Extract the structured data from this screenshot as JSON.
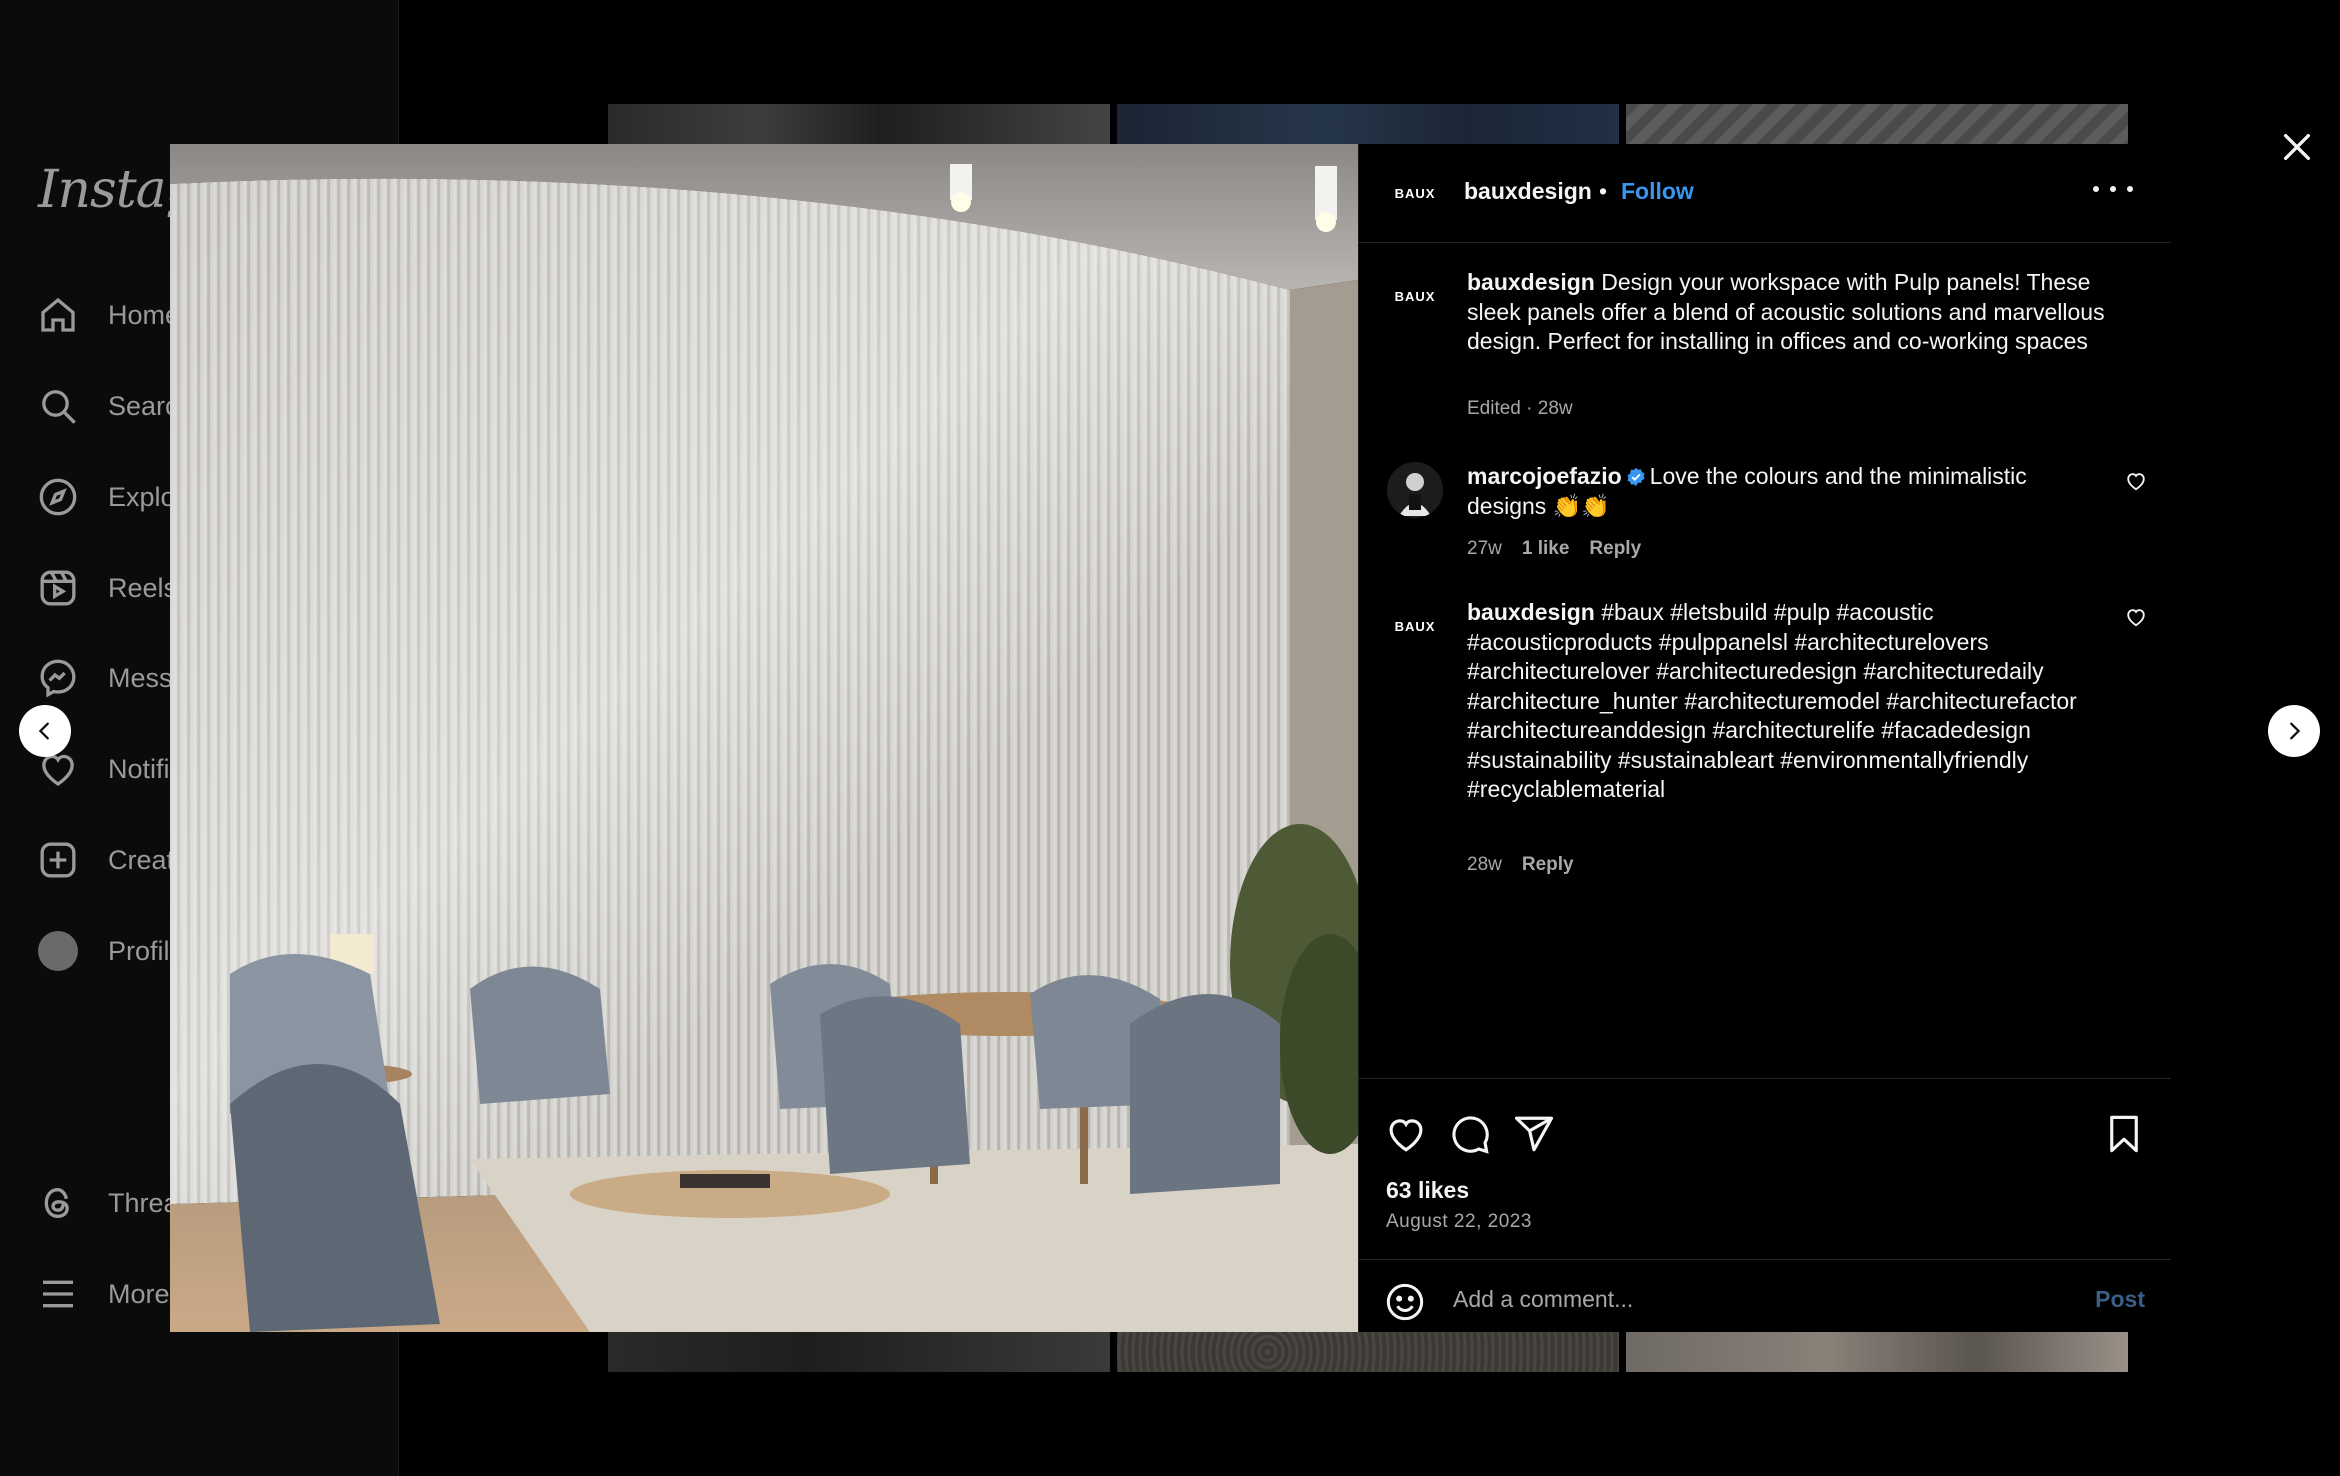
{
  "sidebar": {
    "logo": "Instagram",
    "items": [
      {
        "label": "Home",
        "icon": "home-icon"
      },
      {
        "label": "Search",
        "icon": "search-icon"
      },
      {
        "label": "Explore",
        "icon": "compass-icon"
      },
      {
        "label": "Reels",
        "icon": "reels-icon"
      },
      {
        "label": "Messages",
        "icon": "messenger-icon"
      },
      {
        "label": "Notifications",
        "icon": "heart-icon"
      },
      {
        "label": "Create",
        "icon": "plus-square-icon"
      },
      {
        "label": "Profile",
        "icon": "avatar"
      },
      {
        "label": "Threads",
        "icon": "threads-icon"
      },
      {
        "label": "More",
        "icon": "menu-icon"
      }
    ]
  },
  "post": {
    "header": {
      "avatar_text": "BAUX",
      "username": "bauxdesign",
      "separator": "•",
      "follow_label": "Follow"
    },
    "caption": {
      "avatar_text": "BAUX",
      "username": "bauxdesign",
      "text": "Design your workspace with Pulp panels! These sleek panels offer a blend of acoustic solutions and marvellous design. Perfect for installing in offices and co-working spaces",
      "meta": "Edited · 28w"
    },
    "comments": [
      {
        "username": "marcojoefazio",
        "verified": true,
        "text": "Love the colours and the minimalistic designs 👏👏",
        "time": "27w",
        "likes": "1 like",
        "reply_label": "Reply"
      },
      {
        "avatar_text": "BAUX",
        "username": "bauxdesign",
        "text": "#baux #letsbuild #pulp #acoustic #acousticproducts #pulppanelsl #architecturelovers #architecturelover #architecturedesign #architecturedaily #architecture_hunter #architecturemodel #architecturefactor #architectureanddesign #architecturelife #facadedesign #sustainability #sustainableart #environmentallyfriendly #recyclablematerial",
        "time": "28w",
        "reply_label": "Reply"
      }
    ],
    "likes": "63 likes",
    "date": "August 22, 2023",
    "comment_placeholder": "Add a comment...",
    "post_label": "Post"
  },
  "colors": {
    "accent": "#3897f0",
    "post_disabled": "#3a5f87",
    "verified": "#3897f0"
  }
}
